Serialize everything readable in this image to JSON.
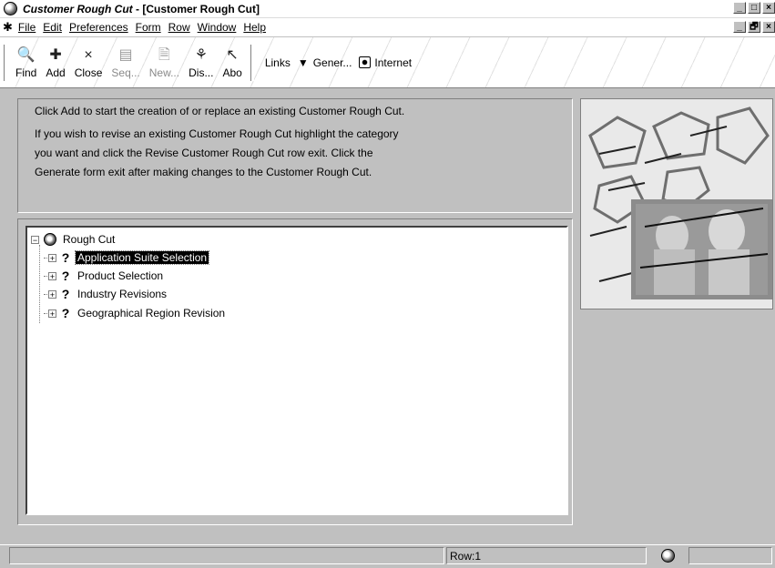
{
  "window": {
    "title_app": "Customer Rough Cut",
    "title_sep": " - ",
    "title_doc": "[Customer Rough Cut]",
    "controls": {
      "minimize": "_",
      "restore": "□",
      "close": "×"
    },
    "doc_controls": {
      "minimize": "_",
      "restore": "🗗",
      "close": "×"
    }
  },
  "menu": [
    {
      "label": "File",
      "icon": "underline-first"
    },
    {
      "label": "Edit"
    },
    {
      "label": "Preferences"
    },
    {
      "label": "Form"
    },
    {
      "label": "Row"
    },
    {
      "label": "Window"
    },
    {
      "label": "Help"
    }
  ],
  "toolbar": {
    "buttons": [
      {
        "label": "Find",
        "icon": "find-icon",
        "glyph": "🔍",
        "enabled": true
      },
      {
        "label": "Add",
        "icon": "add-icon",
        "glyph": "✚",
        "enabled": true
      },
      {
        "label": "Close",
        "icon": "close-icon",
        "glyph": "×",
        "enabled": true
      },
      {
        "label": "Seq...",
        "icon": "sequence-icon",
        "glyph": "▤",
        "enabled": false
      },
      {
        "label": "New...",
        "icon": "new-icon",
        "glyph": "🗎",
        "enabled": false
      },
      {
        "label": "Dis...",
        "icon": "display-icon",
        "glyph": "⚘",
        "enabled": true
      },
      {
        "label": "Abo",
        "icon": "about-icon",
        "glyph": "↖",
        "enabled": true
      }
    ],
    "links_label": "Links",
    "generate_label": "Gener...",
    "internet_label": "Internet"
  },
  "instructions": [
    "Click Add to start the creation of or replace an existing Customer Rough Cut.",
    "If you wish to revise an existing Customer Rough Cut highlight the category",
    "you want and click the Revise Customer Rough Cut row exit.  Click the",
    "Generate form exit after making changes to the Customer Rough Cut."
  ],
  "tree": {
    "root": {
      "label": "Rough Cut",
      "expander": "−"
    },
    "children": [
      {
        "label": "Application Suite Selection",
        "expander": "+",
        "selected": true
      },
      {
        "label": "Product Selection",
        "expander": "+",
        "selected": false
      },
      {
        "label": "Industry Revisions",
        "expander": "+",
        "selected": false
      },
      {
        "label": "Geographical Region Revision",
        "expander": "+",
        "selected": false
      }
    ]
  },
  "status": {
    "row": "Row:1"
  },
  "colors": {
    "chrome": "#c0c0c0",
    "selection": "#000000",
    "window_bg": "#ffffff"
  }
}
